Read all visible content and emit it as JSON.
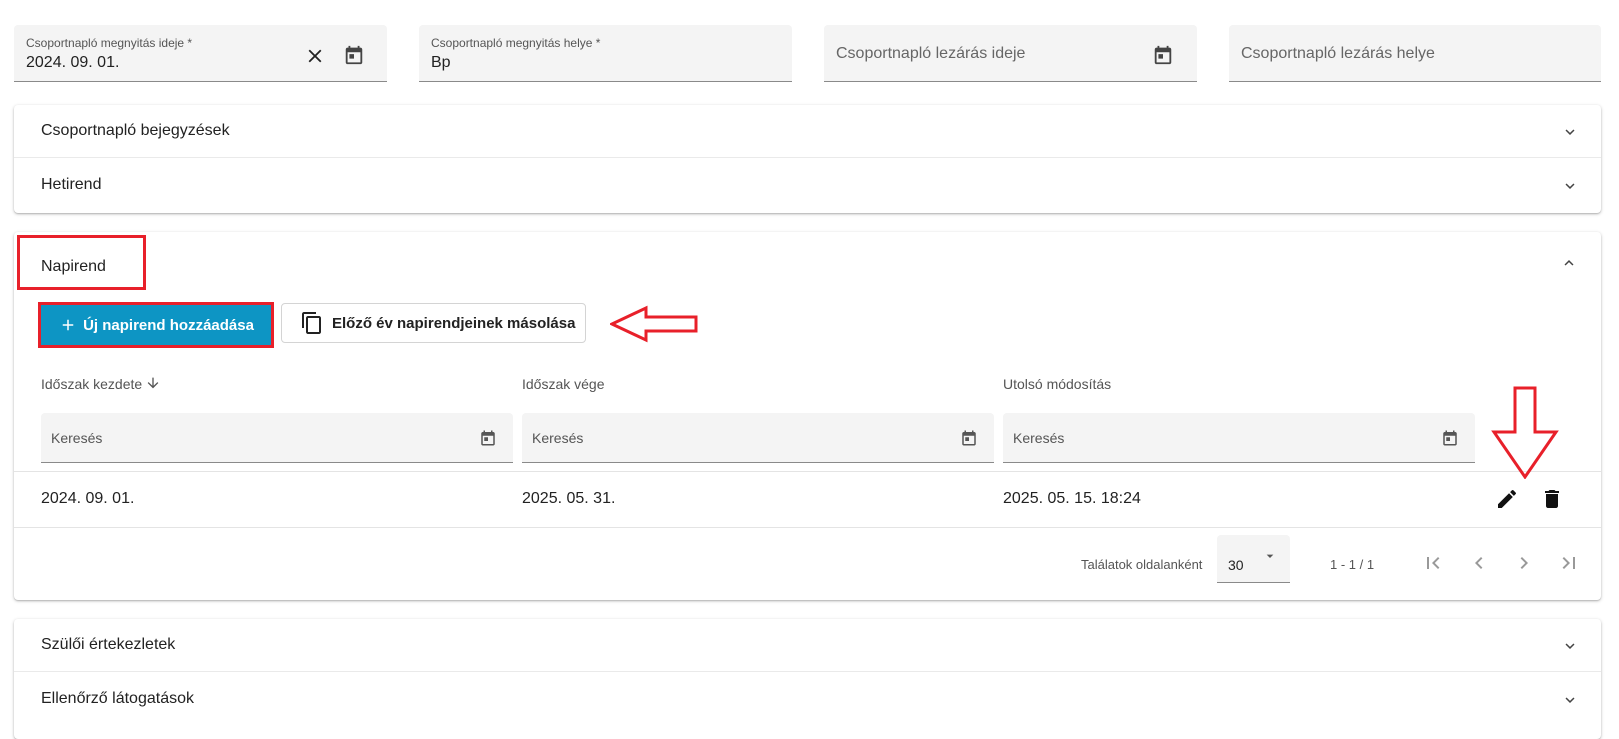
{
  "fields": {
    "opening_date": {
      "label": "Csoportnapló megnyitás ideje *",
      "value": "2024. 09. 01."
    },
    "opening_place": {
      "label": "Csoportnapló megnyitás helye *",
      "value": "Bp"
    },
    "closing_date": {
      "placeholder": "Csoportnapló lezárás ideje"
    },
    "closing_place": {
      "placeholder": "Csoportnapló lezárás helye"
    }
  },
  "sections": {
    "entries": "Csoportnapló bejegyzések",
    "weekly": "Hetirend",
    "daily": "Napirend",
    "parent_meetings": "Szülői értekezletek",
    "inspections": "Ellenőrző látogatások"
  },
  "napirend": {
    "add_button": "Új napirend hozzáadása",
    "copy_button": "Előző év napirendjeinek másolása",
    "columns": [
      "Időszak kezdete",
      "Időszak vége",
      "Utolsó módosítás"
    ],
    "search_placeholder": "Keresés",
    "rows": [
      {
        "start": "2024. 09. 01.",
        "end": "2025. 05. 31.",
        "modified": "2025. 05. 15. 18:24"
      }
    ],
    "pager": {
      "per_page_label": "Találatok oldalanként",
      "per_page_value": "30",
      "range": "1 - 1 / 1"
    }
  },
  "colors": {
    "primary": "#0d95c4",
    "highlight": "#e8202a"
  }
}
